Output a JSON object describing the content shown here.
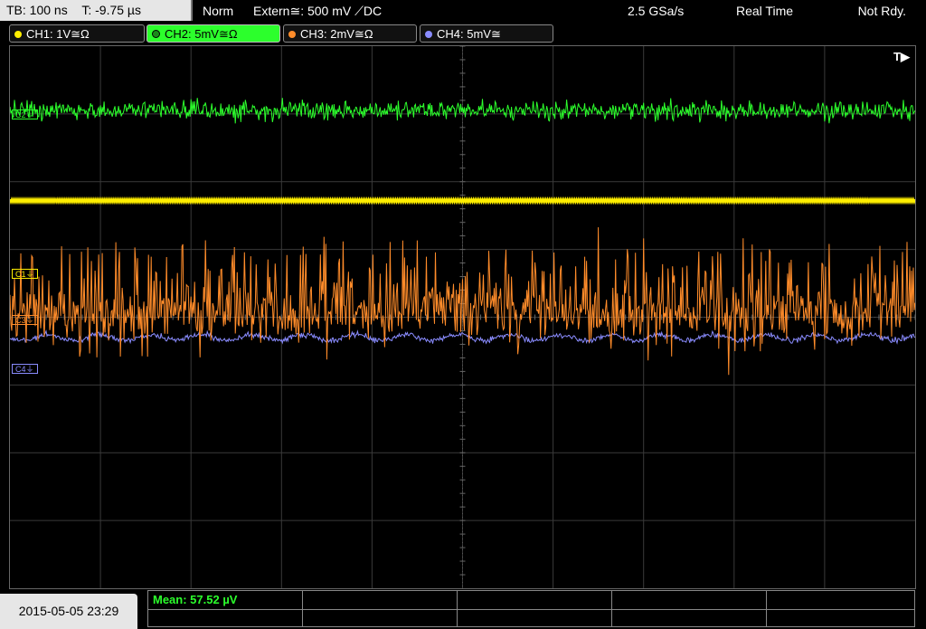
{
  "header": {
    "timebase": "TB: 100 ns",
    "trigger_time": "T: -9.75 µs",
    "mode": "Norm",
    "trigger_source": "Extern≅: 500 mV ⟋DC",
    "sample_rate": "2.5 GSa/s",
    "acq_mode": "Real Time",
    "status": "Not Rdy."
  },
  "channels": [
    {
      "label": "CH1: 1V≅Ω",
      "color": "#ffee00",
      "marker": "C1⏚"
    },
    {
      "label": "CH2: 5mV≅Ω",
      "color": "#2cff2c",
      "marker": "C2⏚"
    },
    {
      "label": "CH3: 2mV≅Ω",
      "color": "#ff8c2a",
      "marker": "C3⏚"
    },
    {
      "label": "CH4: 5mV≅",
      "color": "#8a8cff",
      "marker": "C4⏚"
    }
  ],
  "trigger_marker": "T▶",
  "footer": {
    "datetime": "2015-05-05 23:29",
    "measurement": "Mean: 57.52 µV"
  },
  "chart_data": {
    "type": "line",
    "grid": {
      "divisions_x": 10,
      "divisions_y": 8
    },
    "series": [
      {
        "name": "CH2",
        "color": "#2cff2c",
        "level_div": 0.95,
        "noise_div": 0.12,
        "style": "noise"
      },
      {
        "name": "CH1",
        "color": "#ffee00",
        "level_div": 2.28,
        "noise_div": 0.02,
        "style": "flat"
      },
      {
        "name": "CH3",
        "color": "#ff8c2a",
        "level_div": 3.95,
        "noise_div": 0.45,
        "style": "spiky"
      },
      {
        "name": "CH4",
        "color": "#8a8cff",
        "level_div": 4.3,
        "noise_div": 0.07,
        "style": "wobble"
      }
    ]
  }
}
